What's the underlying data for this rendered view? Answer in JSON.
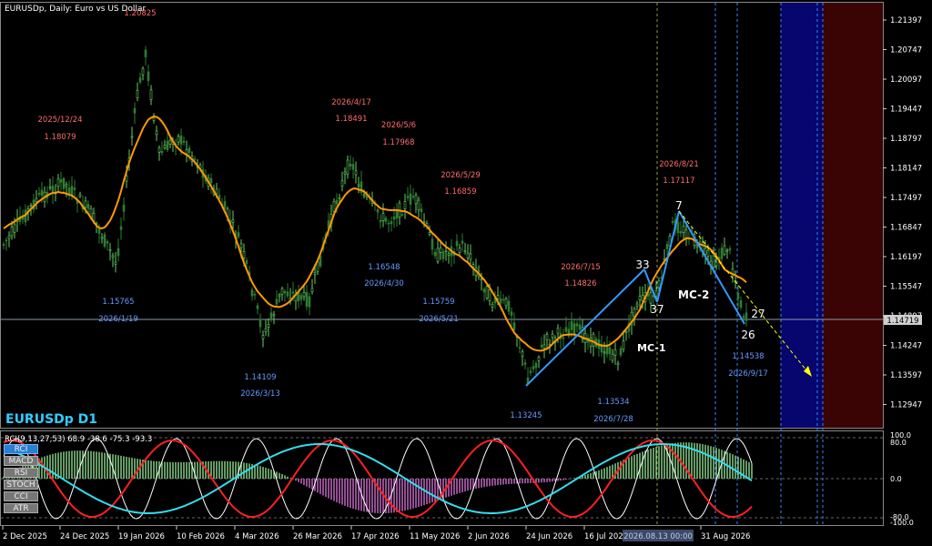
{
  "header": {
    "info": "EURUSDp, Daily:  Euro vs US Dollar",
    "symbol_label": "EURUSDp D1",
    "rci_info": "RCI(9,13,27,53) 68.9 -38.6 -75.3 -93.3"
  },
  "price_axis": {
    "ticks": [
      "1.21397",
      "1.20747",
      "1.20097",
      "1.19447",
      "1.18797",
      "1.18147",
      "1.17497",
      "1.16847",
      "1.16197",
      "1.15547",
      "1.14897",
      "1.14247",
      "1.13597",
      "1.12947"
    ],
    "current_price": "1.14719"
  },
  "indicator_axis": {
    "ticks": [
      "100.0",
      "80.0",
      "0.0",
      "-80.0",
      "-100.0"
    ]
  },
  "date_axis": {
    "labels": [
      "2 Dec 2025",
      "24 Dec 2025",
      "19 Jan 2026",
      "10 Feb 2026",
      "4 Mar 2026",
      "26 Mar 2026",
      "17 Apr 2026",
      "11 May 2026",
      "2 Jun 2026",
      "24 Jun 2026",
      "16 Jul 2026",
      "31 Aug 2026"
    ],
    "crosshair_label": "2026.08.13 00:00"
  },
  "annotations": {
    "highs": [
      {
        "date": "2025/12/24",
        "price": "1.18079"
      },
      {
        "date": "",
        "price": "1.20825"
      },
      {
        "date": "2026/4/17",
        "price": "1.18491"
      },
      {
        "date": "2026/5/6",
        "price": "1.17968"
      },
      {
        "date": "2026/5/29",
        "price": "1.16859"
      },
      {
        "date": "2026/7/15",
        "price": "1.14826"
      },
      {
        "date": "2026/8/21",
        "price": "1.17117"
      }
    ],
    "lows": [
      {
        "price": "1.15765",
        "date": "2026/1/19"
      },
      {
        "price": "1.14109",
        "date": "2026/3/13"
      },
      {
        "price": "1.16548",
        "date": "2026/4/30"
      },
      {
        "price": "1.15759",
        "date": "2026/5/21"
      },
      {
        "price": "1.13245",
        "date": ""
      },
      {
        "price": "1.13534",
        "date": "2026/7/28"
      },
      {
        "price": "1.14538",
        "date": "2026/9/17"
      }
    ],
    "pattern_labels": {
      "mc1": "MC-1",
      "mc2": "MC-2",
      "n33": "33",
      "n37": "37",
      "n7": "7",
      "n26": "26",
      "n27": "27"
    }
  },
  "indicator_buttons": [
    "RCI",
    "MACD",
    "RSI",
    "STOCH",
    "CCI",
    "ATR"
  ],
  "colors": {
    "ma": "#ff9900",
    "bull": "#66cc66",
    "bear": "#2e7d32",
    "pattern": "#3399ff",
    "arrow": "#ffff00",
    "rci_fast": "#ffffff",
    "rci_mid": "#ff2020",
    "rci_slow": "#33ddee",
    "hist_pos": "#8fdc8f",
    "hist_neg": "#d070d0"
  }
}
